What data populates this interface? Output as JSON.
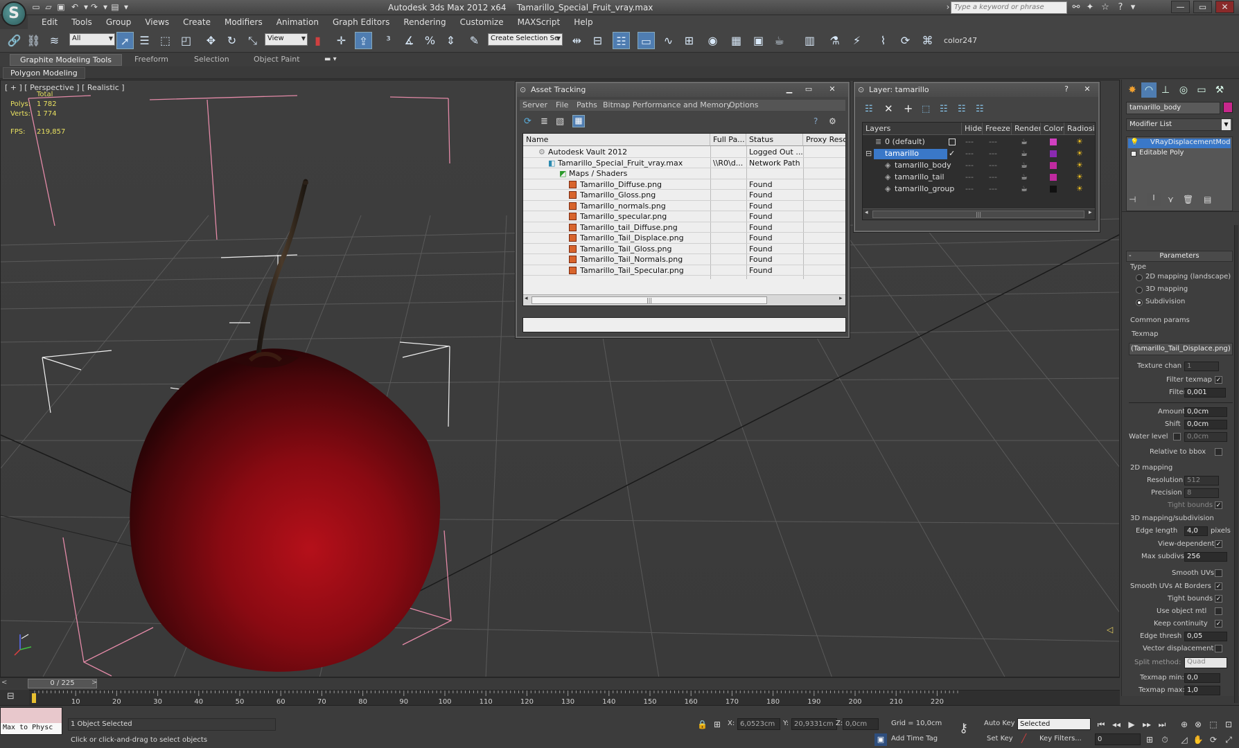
{
  "app": {
    "title": "Autodesk 3ds Max  2012 x64",
    "file": "Tamarillo_Special_Fruit_vray.max",
    "logo_letter": "S"
  },
  "search": {
    "placeholder": "Type a keyword or phrase"
  },
  "menu": [
    "Edit",
    "Tools",
    "Group",
    "Views",
    "Create",
    "Modifiers",
    "Animation",
    "Graph Editors",
    "Rendering",
    "Customize",
    "MAXScript",
    "Help"
  ],
  "toolbar": {
    "selection_filter": "All",
    "ref_coord": "View",
    "selection_set": "Create Selection Se",
    "render_label": "color247"
  },
  "ribbon": {
    "tabs": [
      "Graphite Modeling Tools",
      "Freeform",
      "Selection",
      "Object Paint"
    ],
    "panel": "Polygon Modeling"
  },
  "viewport": {
    "label": "[ + ] [ Perspective ] [ Realistic ]",
    "stats": {
      "total_label": "Total",
      "polys_label": "Polys:",
      "polys": "1 782",
      "verts_label": "Verts:",
      "verts": "1 774",
      "fps_label": "FPS:",
      "fps": "219,857"
    }
  },
  "asset_tracking": {
    "title": "Asset Tracking",
    "menu": [
      "Server",
      "File",
      "Paths",
      "Bitmap Performance and Memory",
      "Options"
    ],
    "columns": [
      "Name",
      "Full Pa...",
      "Status",
      "Proxy Reso"
    ],
    "rows": [
      {
        "name": "Autodesk Vault 2012",
        "path": "",
        "status": "Logged Out ..."
      },
      {
        "name": "Tamarillo_Special_Fruit_vray.max",
        "path": "\\\\R0\\d...",
        "status": "Network Path"
      },
      {
        "name": "Maps / Shaders",
        "path": "",
        "status": ""
      },
      {
        "name": "Tamarillo_Diffuse.png",
        "path": "",
        "status": "Found"
      },
      {
        "name": "Tamarillo_Gloss.png",
        "path": "",
        "status": "Found"
      },
      {
        "name": "Tamarillo_normals.png",
        "path": "",
        "status": "Found"
      },
      {
        "name": "Tamarillo_specular.png",
        "path": "",
        "status": "Found"
      },
      {
        "name": "Tamarillo_tail_Diffuse.png",
        "path": "",
        "status": "Found"
      },
      {
        "name": "Tamarillo_Tail_Displace.png",
        "path": "",
        "status": "Found"
      },
      {
        "name": "Tamarillo_Tail_Gloss.png",
        "path": "",
        "status": "Found"
      },
      {
        "name": "Tamarillo_Tail_Normals.png",
        "path": "",
        "status": "Found"
      },
      {
        "name": "Tamarillo_Tail_Specular.png",
        "path": "",
        "status": "Found"
      }
    ]
  },
  "layers": {
    "title": "Layer: tamarillo",
    "columns": [
      "Layers",
      "Hide",
      "Freeze",
      "Render",
      "Color",
      "Radiosity"
    ],
    "rows": [
      {
        "name": "0 (default)",
        "color": "#d040c0"
      },
      {
        "name": "tamarillo",
        "color": "#8a2ab0"
      },
      {
        "name": "tamarillo_body",
        "color": "#c02aa0"
      },
      {
        "name": "tamarillo_tail",
        "color": "#c02aa0"
      },
      {
        "name": "tamarillo_group",
        "color": "#111111"
      }
    ]
  },
  "command_panel": {
    "object_name": "tamarillo_body",
    "object_color": "#c8288c",
    "modifier_list": "Modifier List",
    "stack": [
      "VRayDisplacementMod",
      "Editable Poly"
    ],
    "params": {
      "title": "Parameters",
      "type_label": "Type",
      "type_options": [
        "2D mapping (landscape)",
        "3D mapping",
        "Subdivision"
      ],
      "common_label": "Common params",
      "texmap_label": "Texmap",
      "texmap_value": "(Tamarillo_Tail_Displace.png)",
      "texture_chan_label": "Texture chan",
      "texture_chan": "1",
      "filter_texmap_label": "Filter texmap",
      "filter_blur_label": "Filter blur",
      "filter_blur": "0,001",
      "amount_label": "Amount",
      "amount": "0,0cm",
      "shift_label": "Shift",
      "shift": "0,0cm",
      "water_label": "Water level",
      "water": "0,0cm",
      "relative_label": "Relative to bbox",
      "map2d_label": "2D mapping",
      "resolution_label": "Resolution",
      "resolution": "512",
      "precision_label": "Precision",
      "precision": "8",
      "tight_label": "Tight bounds",
      "map3d_label": "3D mapping/subdivision",
      "edge_length_label": "Edge length",
      "edge_length": "4,0",
      "pixels_label": "pixels",
      "view_dep_label": "View-dependent",
      "max_subdivs_label": "Max subdivs",
      "max_subdivs": "256",
      "smooth_uvs_label": "Smooth UVs",
      "smooth_borders_label": "Smooth UVs At Borders",
      "tight2_label": "Tight bounds",
      "use_mtl_label": "Use object mtl",
      "keep_cont_label": "Keep continuity",
      "edge_thresh_label": "Edge thresh",
      "edge_thresh": "0,05",
      "vector_disp_label": "Vector displacement",
      "split_label": "Split method:",
      "split": "Quad",
      "tex_min_label": "Texmap min:",
      "tex_min": "0,0",
      "tex_max_label": "Texmap max:",
      "tex_max": "1,0"
    }
  },
  "timeline": {
    "frame": "0 / 225",
    "ticks": [
      "10",
      "20",
      "30",
      "40",
      "50",
      "60",
      "70",
      "80",
      "90",
      "100",
      "110",
      "120",
      "130",
      "140",
      "150",
      "160",
      "170",
      "180",
      "190",
      "200",
      "210",
      "220"
    ]
  },
  "status": {
    "maxscript": "Max to Physc",
    "selected": "1 Object Selected",
    "prompt": "Click or click-and-drag to select objects",
    "x_label": "X:",
    "x": "6,0523cm",
    "y_label": "Y:",
    "y": "20,9331cm",
    "z_label": "Z:",
    "z": "0,0cm",
    "grid": "Grid = 10,0cm",
    "add_time_tag": "Add Time Tag",
    "auto_key": "Auto Key",
    "set_key": "Set Key",
    "key_mode": "Selected",
    "key_filters": "Key Filters...",
    "frame": "0"
  }
}
